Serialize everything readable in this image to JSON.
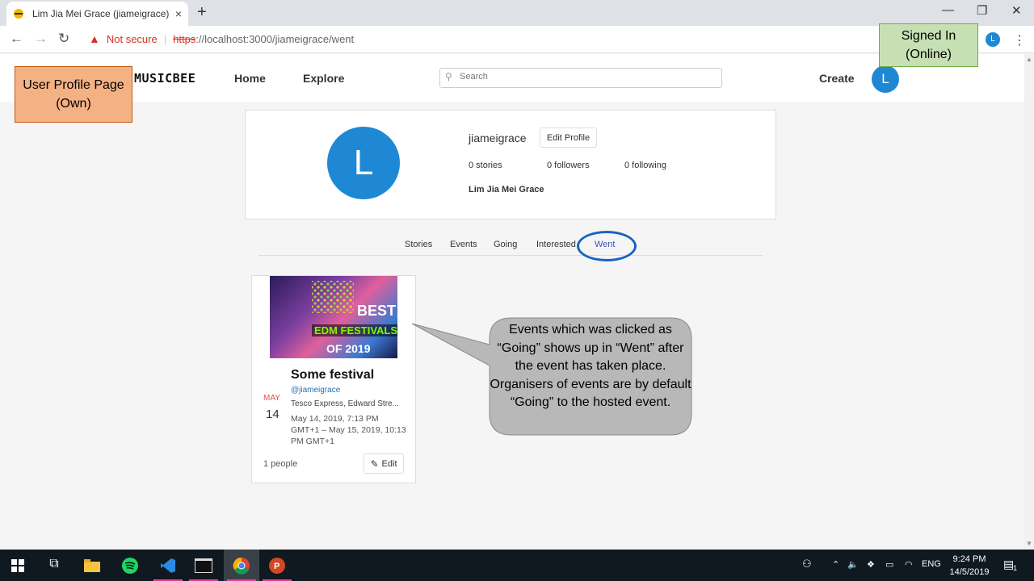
{
  "browser": {
    "tab_title": "Lim Jia Mei Grace (jiameigrace) -",
    "tab_close": "×",
    "new_tab": "+",
    "url_warning": "Not secure",
    "url_https": "https",
    "url_rest": "://localhost:3000/jiameigrace/went",
    "profile_initial": "L"
  },
  "site": {
    "logo": "MUSICBEE",
    "nav": {
      "home": "Home",
      "explore": "Explore"
    },
    "search_placeholder": "Search",
    "create": "Create",
    "avatar_initial": "L"
  },
  "profile": {
    "avatar_initial": "L",
    "username": "jiameigrace",
    "edit_profile": "Edit Profile",
    "stories": "0 stories",
    "followers": "0 followers",
    "following": "0 following",
    "full_name": "Lim Jia Mei Grace"
  },
  "tabs": {
    "stories": "Stories",
    "events": "Events",
    "going": "Going",
    "interested": "Interested",
    "went": "Went"
  },
  "event": {
    "image_text_1": "BEST",
    "image_text_2": "EDM FESTIVALS",
    "image_text_3": "OF 2019",
    "title": "Some festival",
    "organiser": "@jiameigrace",
    "month": "MAY",
    "day": "14",
    "venue": "Tesco Express, Edward Stre...",
    "datetime": "May 14, 2019, 7:13 PM GMT+1 – May 15, 2019, 10:13 PM GMT+1",
    "people": "1 people",
    "edit": "Edit"
  },
  "annotations": {
    "own_page": "User Profile Page (Own)",
    "signed_in": "Signed In (Online)",
    "callout": "Events which was clicked as “Going” shows up in “Went” after the event has taken place. Organisers of events are by default “Going” to the hosted event."
  },
  "taskbar": {
    "lang": "ENG",
    "time": "9:24 PM",
    "date": "14/5/2019",
    "notification_count": "1"
  }
}
